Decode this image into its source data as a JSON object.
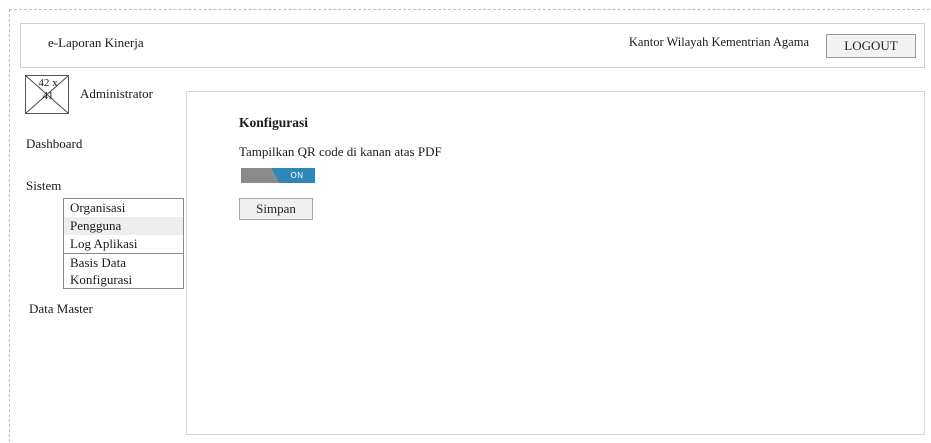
{
  "header": {
    "app_title": "e-Laporan Kinerja",
    "org_name": "Kantor Wilayah Kementrian Agama",
    "logout_label": "LOGOUT"
  },
  "user": {
    "avatar_line1": "42 x",
    "avatar_line2": "41",
    "name": "Administrator"
  },
  "sidebar": {
    "dashboard": "Dashboard",
    "sistem": "Sistem",
    "sistem_items": [
      "Organisasi",
      "Pengguna",
      "Log Aplikasi",
      "Basis Data",
      "Konfigurasi"
    ],
    "data_master": "Data Master"
  },
  "main": {
    "title": "Konfigurasi",
    "setting_label": "Tampilkan QR code di kanan atas PDF",
    "toggle": {
      "state_label": "ON",
      "on": true
    },
    "save_label": "Simpan"
  },
  "colors": {
    "toggle_on": "#2f86b8",
    "toggle_off": "#8a8a8a"
  }
}
